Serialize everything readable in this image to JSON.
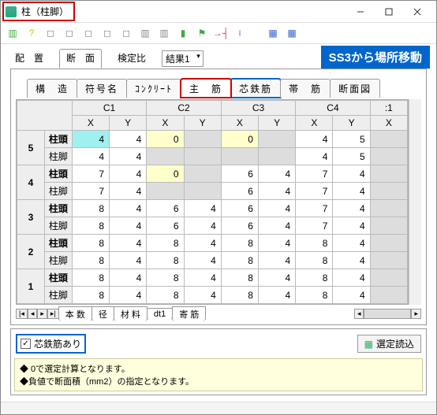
{
  "window": {
    "title": "柱（柱脚）"
  },
  "main_tabs": {
    "items": [
      "配　置",
      "断　面",
      "検定比"
    ],
    "active": 1,
    "dropdown": "結果1"
  },
  "banner": "SS3から場所移動",
  "sub_tabs": {
    "items": [
      "構　造",
      "符号名",
      "ｺﾝｸﾘｰﾄ",
      "主　筋",
      "芯鉄筋",
      "帯　筋",
      "断面図"
    ],
    "active": 3
  },
  "columns": [
    "C1",
    "C2",
    "C3",
    "C4"
  ],
  "sub_columns": [
    "X",
    "Y",
    "X",
    "Y",
    "X",
    "Y",
    "X",
    "Y",
    "X"
  ],
  "extra_col_head": ":1",
  "row_labels": {
    "top": "柱頭",
    "bottom": "柱脚"
  },
  "rows": [
    {
      "id": "5",
      "top": [
        {
          "v": "4",
          "cls": "hl-cyan"
        },
        {
          "v": "4"
        },
        {
          "v": "0",
          "cls": "hl-yellow"
        },
        {
          "v": "",
          "cls": "grey"
        },
        {
          "v": "0",
          "cls": "hl-yellow"
        },
        {
          "v": "",
          "cls": "grey"
        },
        {
          "v": "4"
        },
        {
          "v": "5"
        }
      ],
      "bot": [
        {
          "v": "4"
        },
        {
          "v": "4"
        },
        {
          "v": "",
          "cls": "grey"
        },
        {
          "v": "",
          "cls": "grey"
        },
        {
          "v": "",
          "cls": "grey"
        },
        {
          "v": "",
          "cls": "grey"
        },
        {
          "v": "4"
        },
        {
          "v": "5"
        }
      ]
    },
    {
      "id": "4",
      "top": [
        {
          "v": "7"
        },
        {
          "v": "4"
        },
        {
          "v": "0",
          "cls": "hl-yellow"
        },
        {
          "v": "",
          "cls": "grey"
        },
        {
          "v": "6"
        },
        {
          "v": "4"
        },
        {
          "v": "7"
        },
        {
          "v": "4"
        }
      ],
      "bot": [
        {
          "v": "7"
        },
        {
          "v": "4"
        },
        {
          "v": "",
          "cls": "grey"
        },
        {
          "v": "",
          "cls": "grey"
        },
        {
          "v": "6"
        },
        {
          "v": "4"
        },
        {
          "v": "7"
        },
        {
          "v": "4"
        }
      ]
    },
    {
      "id": "3",
      "top": [
        {
          "v": "8"
        },
        {
          "v": "4"
        },
        {
          "v": "6"
        },
        {
          "v": "4"
        },
        {
          "v": "6"
        },
        {
          "v": "4"
        },
        {
          "v": "7"
        },
        {
          "v": "4"
        }
      ],
      "bot": [
        {
          "v": "8"
        },
        {
          "v": "4"
        },
        {
          "v": "6"
        },
        {
          "v": "4"
        },
        {
          "v": "6"
        },
        {
          "v": "4"
        },
        {
          "v": "7"
        },
        {
          "v": "4"
        }
      ]
    },
    {
      "id": "2",
      "top": [
        {
          "v": "8"
        },
        {
          "v": "4"
        },
        {
          "v": "8"
        },
        {
          "v": "4"
        },
        {
          "v": "8"
        },
        {
          "v": "4"
        },
        {
          "v": "8"
        },
        {
          "v": "4"
        }
      ],
      "bot": [
        {
          "v": "8"
        },
        {
          "v": "4"
        },
        {
          "v": "8"
        },
        {
          "v": "4"
        },
        {
          "v": "8"
        },
        {
          "v": "4"
        },
        {
          "v": "8"
        },
        {
          "v": "4"
        }
      ]
    },
    {
      "id": "1",
      "top": [
        {
          "v": "8"
        },
        {
          "v": "4"
        },
        {
          "v": "8"
        },
        {
          "v": "4"
        },
        {
          "v": "8"
        },
        {
          "v": "4"
        },
        {
          "v": "8"
        },
        {
          "v": "4"
        }
      ],
      "bot": [
        {
          "v": "8"
        },
        {
          "v": "4"
        },
        {
          "v": "8"
        },
        {
          "v": "4"
        },
        {
          "v": "8"
        },
        {
          "v": "4"
        },
        {
          "v": "8"
        },
        {
          "v": "4"
        }
      ]
    }
  ],
  "sheet_tabs": [
    "本 数",
    "径",
    "材 料",
    "dt1",
    "寄 筋"
  ],
  "checkbox": {
    "label": "芯鉄筋あり",
    "checked": true
  },
  "load_button": "選定読込",
  "info_lines": [
    "◆ 0で選定計算となります。",
    "◆負値で断面積（mm2）の指定となります。"
  ]
}
